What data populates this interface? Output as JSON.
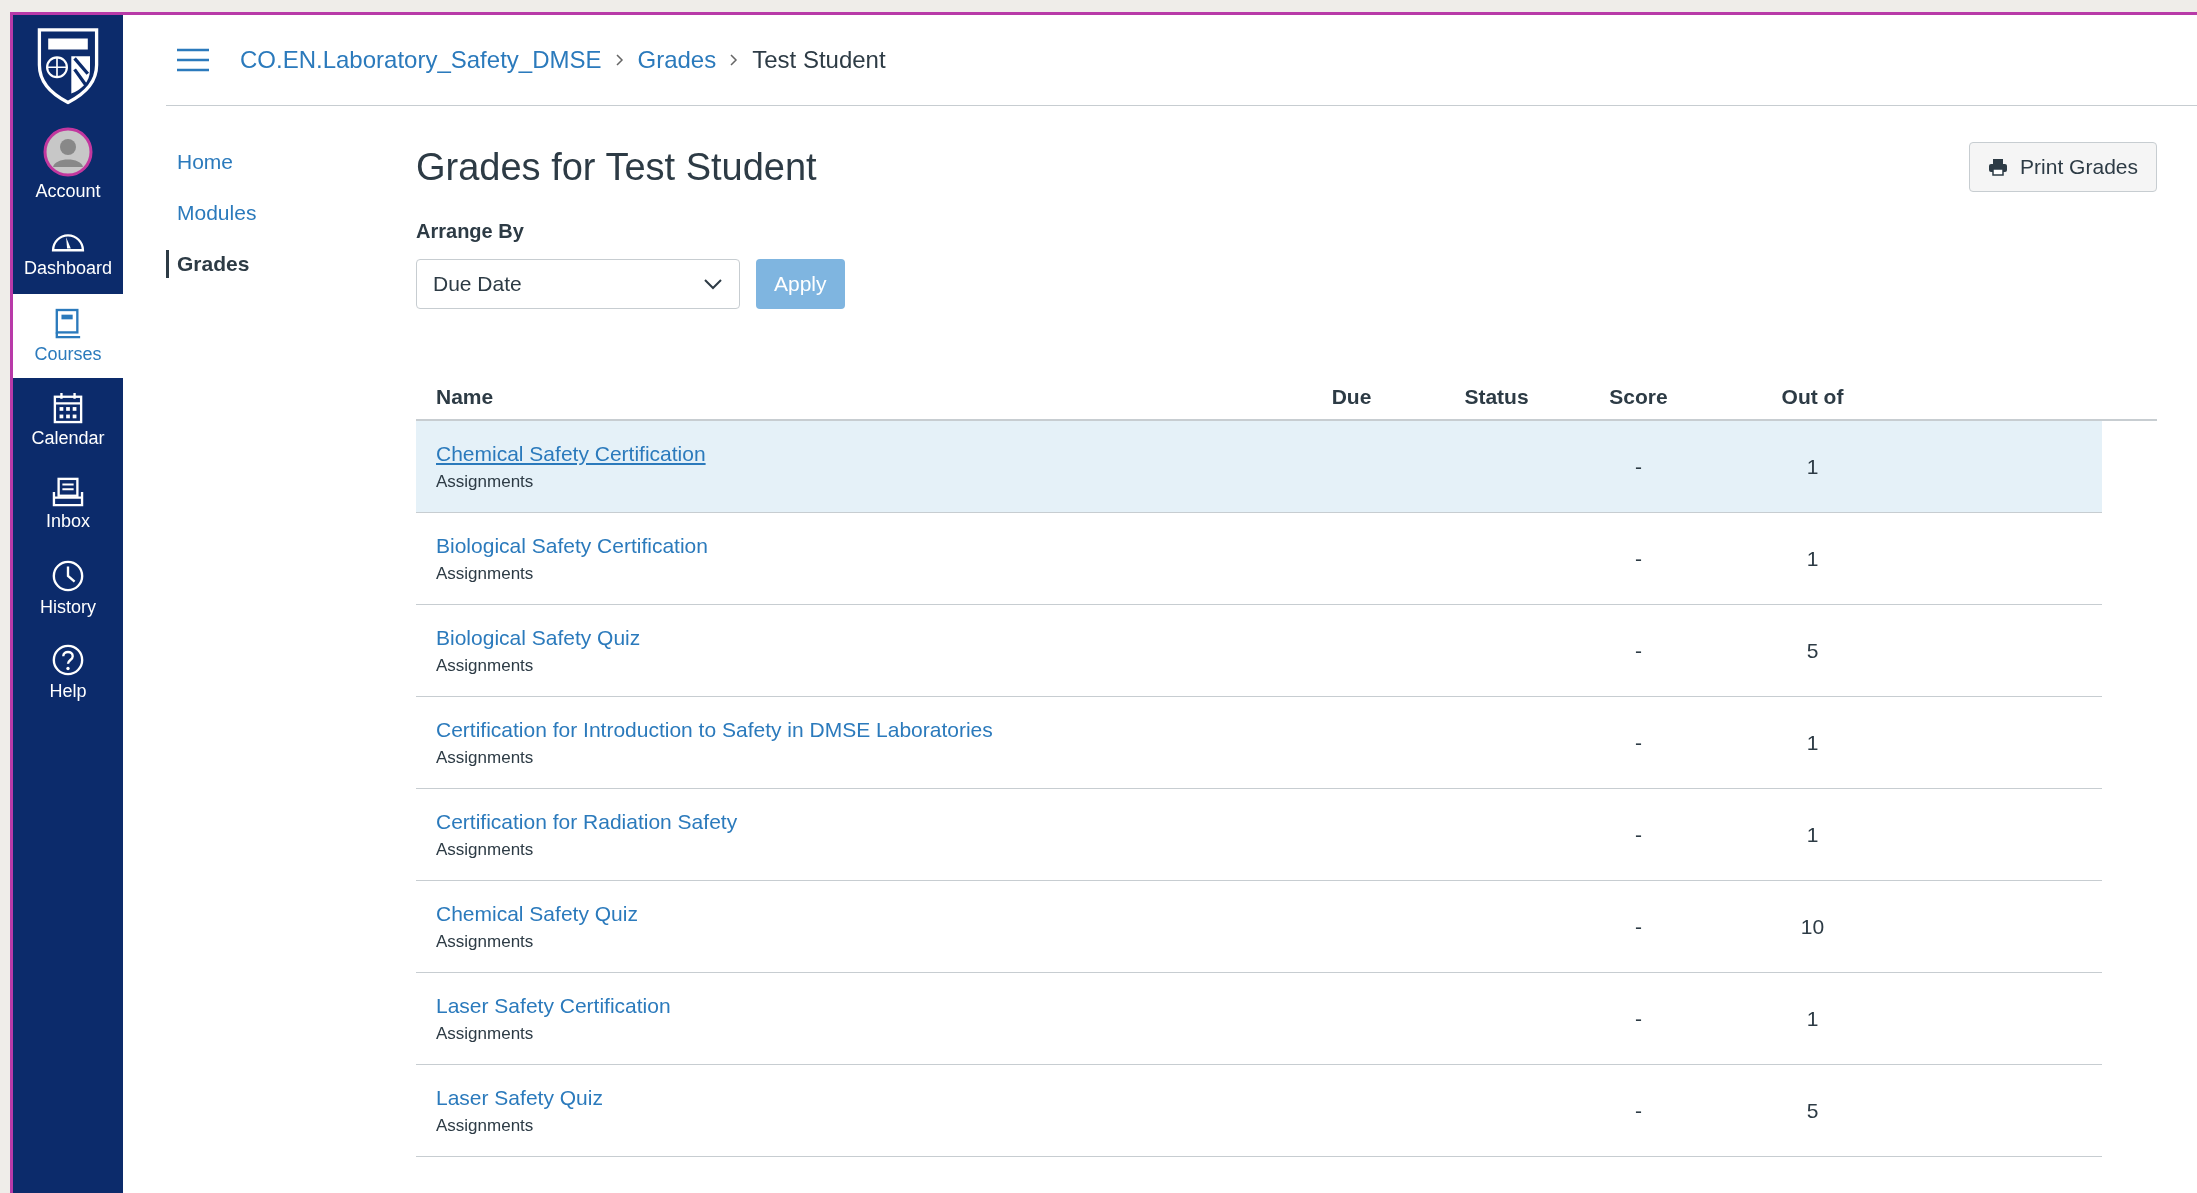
{
  "global_nav": [
    {
      "kind": "avatar",
      "label": "Account",
      "selected": false
    },
    {
      "kind": "dashboard",
      "label": "Dashboard",
      "selected": false
    },
    {
      "kind": "courses",
      "label": "Courses",
      "selected": true
    },
    {
      "kind": "calendar",
      "label": "Calendar",
      "selected": false
    },
    {
      "kind": "inbox",
      "label": "Inbox",
      "selected": false
    },
    {
      "kind": "history",
      "label": "History",
      "selected": false
    },
    {
      "kind": "help",
      "label": "Help",
      "selected": false
    }
  ],
  "breadcrumb": [
    {
      "label": "CO.EN.Laboratory_Safety_DMSE",
      "link": true
    },
    {
      "label": "Grades",
      "link": true
    },
    {
      "label": "Test Student",
      "link": false
    }
  ],
  "course_nav": [
    {
      "label": "Home",
      "selected": false
    },
    {
      "label": "Modules",
      "selected": false
    },
    {
      "label": "Grades",
      "selected": true
    }
  ],
  "title": "Grades for Test Student",
  "print_button": "Print Grades",
  "arrange_by": {
    "label": "Arrange By",
    "value": "Due Date",
    "button": "Apply"
  },
  "table": {
    "columns": [
      "Name",
      "Due",
      "Status",
      "Score",
      "Out of"
    ],
    "rows": [
      {
        "name": "Chemical Safety Certification",
        "group": "Assignments",
        "score": "-",
        "out_of": "1",
        "highlighted": true
      },
      {
        "name": "Biological Safety Certification",
        "group": "Assignments",
        "score": "-",
        "out_of": "1",
        "highlighted": false
      },
      {
        "name": "Biological Safety Quiz",
        "group": "Assignments",
        "score": "-",
        "out_of": "5",
        "highlighted": false
      },
      {
        "name": "Certification for Introduction to Safety in DMSE Laboratories",
        "group": "Assignments",
        "score": "-",
        "out_of": "1",
        "highlighted": false
      },
      {
        "name": "Certification for Radiation Safety",
        "group": "Assignments",
        "score": "-",
        "out_of": "1",
        "highlighted": false
      },
      {
        "name": "Chemical Safety Quiz",
        "group": "Assignments",
        "score": "-",
        "out_of": "10",
        "highlighted": false
      },
      {
        "name": "Laser Safety Certification",
        "group": "Assignments",
        "score": "-",
        "out_of": "1",
        "highlighted": false
      },
      {
        "name": "Laser Safety Quiz",
        "group": "Assignments",
        "score": "-",
        "out_of": "5",
        "highlighted": false
      }
    ]
  }
}
